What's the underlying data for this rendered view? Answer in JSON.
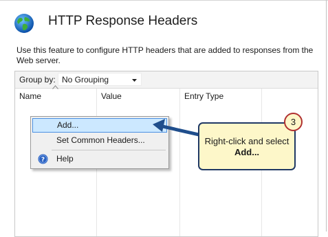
{
  "header": {
    "title": "HTTP Response Headers",
    "description": "Use this feature to configure HTTP headers that are added to responses from the Web server.",
    "icon": "globe-icon"
  },
  "toolbar": {
    "groupby_label": "Group by:",
    "groupby_value": "No Grouping"
  },
  "table": {
    "columns": [
      "Name",
      "Value",
      "Entry Type"
    ]
  },
  "context_menu": {
    "items": [
      {
        "label": "Add...",
        "selected": true
      },
      {
        "label": "Set Common Headers...",
        "selected": false
      },
      {
        "label": "Help",
        "icon": "help-icon",
        "selected": false
      }
    ]
  },
  "callout": {
    "step_number": "3",
    "text_prefix": "Right-click and select ",
    "text_bold": "Add..."
  },
  "colors": {
    "callout_fill": "#fdf7c9",
    "callout_border": "#1f3864",
    "arrow": "#1f4e8c",
    "badge_border": "#b03030",
    "menu_highlight": "#cce8ff"
  }
}
